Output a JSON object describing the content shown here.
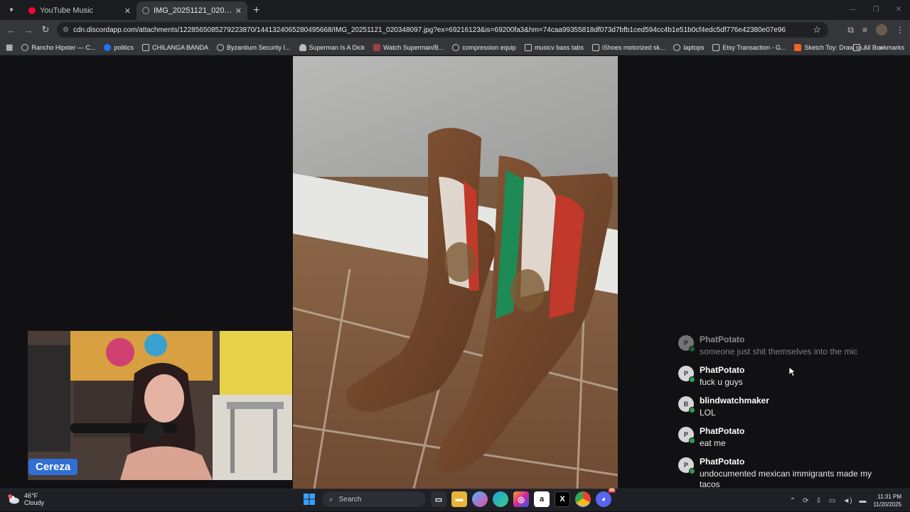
{
  "browser": {
    "tabs": [
      {
        "label": "YouTube Music",
        "active": false,
        "favicon_color": "#ff0033"
      },
      {
        "label": "IMG_20251121_020348097.jpg",
        "active": true,
        "favicon_color": "#9aa0a6"
      }
    ],
    "url": "cdn.discordapp.com/attachments/1228565085279223870/1441324065280495668/IMG_20251121_020348097.jpg?ex=69216123&is=69200fa3&hm=74caa99355818df073d7bfb1ced594cc4b1e51b0cf4edc5df776e42380e07e96",
    "bookmarks": [
      {
        "label": "Rancho Hipster — C...",
        "icon": "globe-icon"
      },
      {
        "label": "politics",
        "icon": "facebook-icon"
      },
      {
        "label": "CHILANGA BANDA",
        "icon": "folder-icon"
      },
      {
        "label": "Byzantium Security I...",
        "icon": "globe-icon"
      },
      {
        "label": "Superman Is A Dick",
        "icon": "bell-icon"
      },
      {
        "label": "Watch Superman/B...",
        "icon": "image-icon"
      },
      {
        "label": "compression equip",
        "icon": "globe-icon"
      },
      {
        "label": "musicv bass tabs",
        "icon": "folder-icon"
      },
      {
        "label": "iShoes motorized sk...",
        "icon": "folder-icon"
      },
      {
        "label": "laptops",
        "icon": "globe-icon"
      },
      {
        "label": "Etsy Transaction - G...",
        "icon": "folder-icon"
      },
      {
        "label": "Sketch Toy: Draw sk...",
        "icon": "etsy-icon"
      }
    ],
    "all_bookmarks_label": "All Bookmarks"
  },
  "stream": {
    "streamer_name": "Cereza"
  },
  "chat": {
    "messages": [
      {
        "initial": "P",
        "user": "PhatPotato",
        "text": "someone just shit themselves into the mic",
        "faded": true
      },
      {
        "initial": "P",
        "user": "PhatPotato",
        "text": "fuck u guys",
        "faded": false
      },
      {
        "initial": "B",
        "user": "blindwatchmaker",
        "text": "LOL",
        "faded": false
      },
      {
        "initial": "P",
        "user": "PhatPotato",
        "text": "eat me",
        "faded": false
      },
      {
        "initial": "P",
        "user": "PhatPotato",
        "text": "undocumented mexican immigrants made my tacos",
        "faded": false
      }
    ]
  },
  "taskbar": {
    "weather_temp": "46°F",
    "weather_desc": "Cloudy",
    "weather_alert": "1",
    "search_placeholder": "Search",
    "time": "11:31 PM",
    "date": "11/20/2025",
    "notification_count": "99"
  }
}
